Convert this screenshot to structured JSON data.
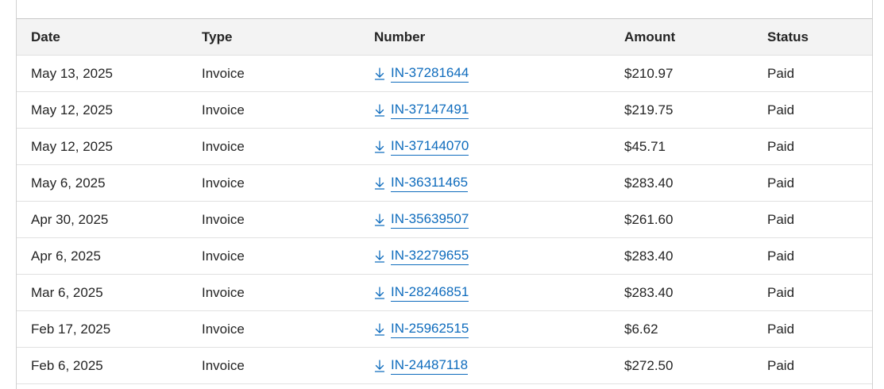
{
  "table": {
    "headers": {
      "date": "Date",
      "type": "Type",
      "number": "Number",
      "amount": "Amount",
      "status": "Status"
    },
    "rows": [
      {
        "date": "May 13, 2025",
        "type": "Invoice",
        "number": "IN-37281644",
        "amount": "$210.97",
        "status": "Paid"
      },
      {
        "date": "May 12, 2025",
        "type": "Invoice",
        "number": "IN-37147491",
        "amount": "$219.75",
        "status": "Paid"
      },
      {
        "date": "May 12, 2025",
        "type": "Invoice",
        "number": "IN-37144070",
        "amount": "$45.71",
        "status": "Paid"
      },
      {
        "date": "May 6, 2025",
        "type": "Invoice",
        "number": "IN-36311465",
        "amount": "$283.40",
        "status": "Paid"
      },
      {
        "date": "Apr 30, 2025",
        "type": "Invoice",
        "number": "IN-35639507",
        "amount": "$261.60",
        "status": "Paid"
      },
      {
        "date": "Apr 6, 2025",
        "type": "Invoice",
        "number": "IN-32279655",
        "amount": "$283.40",
        "status": "Paid"
      },
      {
        "date": "Mar 6, 2025",
        "type": "Invoice",
        "number": "IN-28246851",
        "amount": "$283.40",
        "status": "Paid"
      },
      {
        "date": "Feb 17, 2025",
        "type": "Invoice",
        "number": "IN-25962515",
        "amount": "$6.62",
        "status": "Paid"
      },
      {
        "date": "Feb 6, 2025",
        "type": "Invoice",
        "number": "IN-24487118",
        "amount": "$272.50",
        "status": "Paid"
      }
    ],
    "link_icon": "download-icon",
    "link_color": "#0f6cbd"
  }
}
